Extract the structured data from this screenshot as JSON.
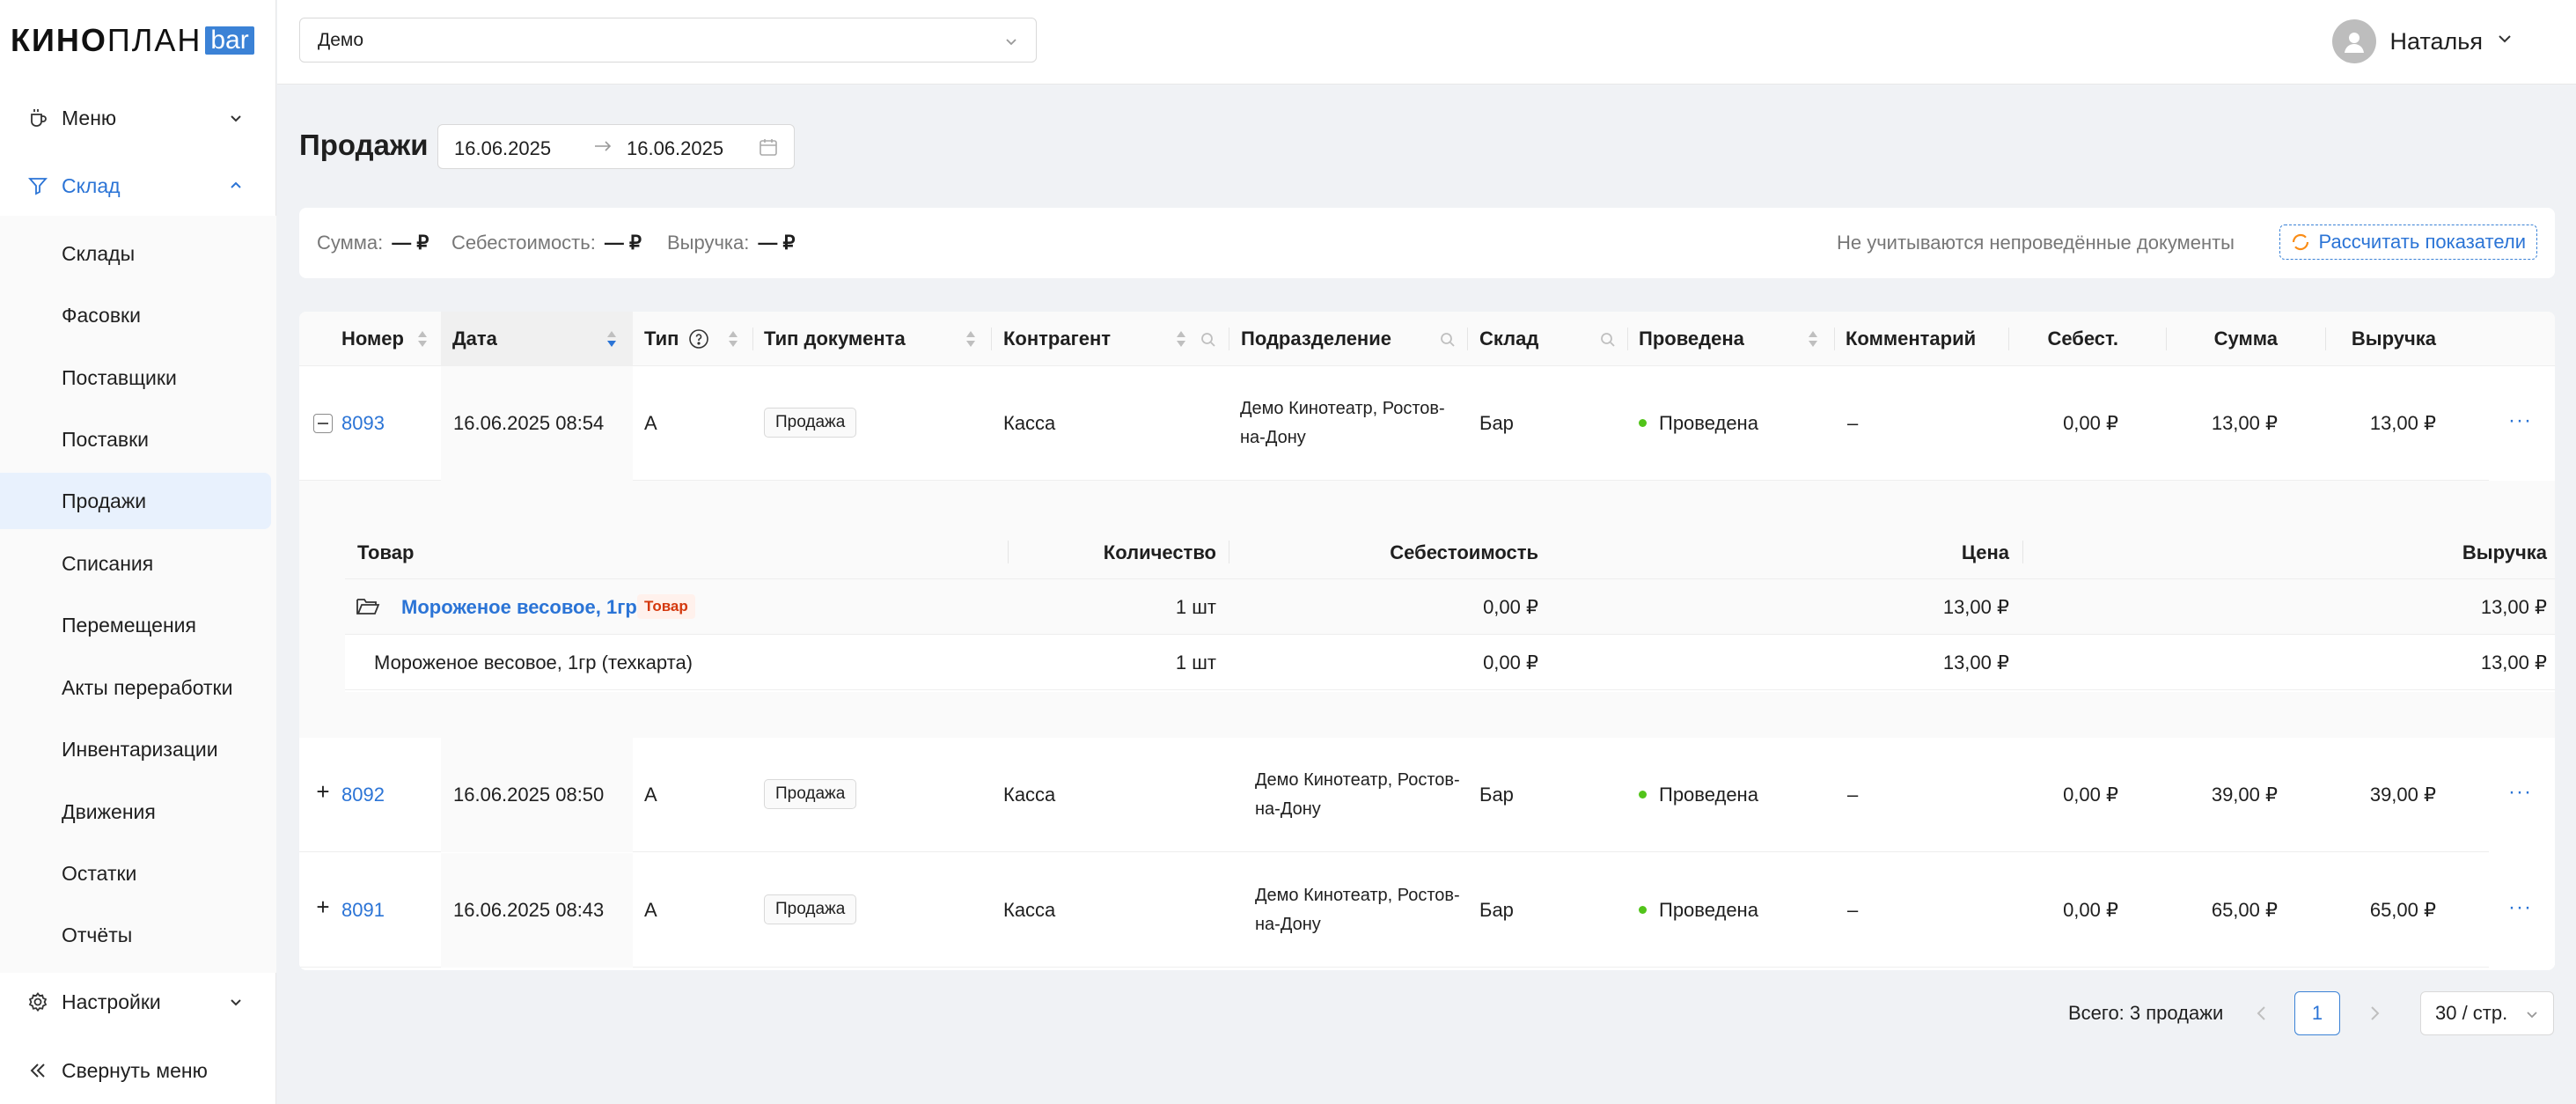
{
  "logo": {
    "bold": "КИНО",
    "light": "ПЛАН",
    "badge": "bar"
  },
  "sidebar": {
    "groups": [
      {
        "label": "Меню",
        "icon": "cup-icon"
      },
      {
        "label": "Склад",
        "icon": "funnel-icon"
      },
      {
        "label": "Настройки",
        "icon": "gear-icon"
      },
      {
        "label": "Свернуть меню",
        "icon": "double-chevron-left-icon"
      }
    ],
    "items": [
      "Склады",
      "Фасовки",
      "Поставщики",
      "Поставки",
      "Продажи",
      "Списания",
      "Перемещения",
      "Акты переработки",
      "Инвентаризации",
      "Движения",
      "Остатки",
      "Отчёты"
    ],
    "selected_item": "Продажи"
  },
  "topbar": {
    "org_select": "Демо",
    "user_name": "Наталья"
  },
  "page": {
    "title": "Продажи",
    "date_from": "16.06.2025",
    "date_to": "16.06.2025"
  },
  "metrics": {
    "sum_label": "Сумма:",
    "sum_value": "— ₽",
    "cost_label": "Себестоимость:",
    "cost_value": "— ₽",
    "revenue_label": "Выручка:",
    "revenue_value": "— ₽",
    "note": "Не учитываются непроведённые документы",
    "calc_button": "Рассчитать показатели"
  },
  "table": {
    "headers": {
      "number": "Номер",
      "date": "Дата",
      "type": "Тип",
      "doc_type": "Тип документа",
      "counterparty": "Контрагент",
      "division": "Подразделение",
      "warehouse": "Склад",
      "posted": "Проведена",
      "comment": "Комментарий",
      "cost": "Себест.",
      "sum": "Сумма",
      "revenue": "Выручка"
    },
    "rows": [
      {
        "number": "8093",
        "date": "16.06.2025 08:54",
        "type": "А",
        "doc_type": "Продажа",
        "counterparty": "Касса",
        "division_1": "Демо Кинотеатр, Ростов-",
        "division_2": "на-Дону",
        "warehouse": "Бар",
        "posted": "Проведена",
        "comment": "–",
        "cost": "0,00 ₽",
        "sum": "13,00 ₽",
        "revenue": "13,00 ₽",
        "more": "···"
      },
      {
        "number": "8092",
        "date": "16.06.2025 08:50",
        "type": "А",
        "doc_type": "Продажа",
        "counterparty": "Касса",
        "division_1": "Демо Кинотеатр, Ростов-",
        "division_2": "на-Дону",
        "warehouse": "Бар",
        "posted": "Проведена",
        "comment": "–",
        "cost": "0,00 ₽",
        "sum": "39,00 ₽",
        "revenue": "39,00 ₽",
        "more": "···",
        "expand": "+"
      },
      {
        "number": "8091",
        "date": "16.06.2025 08:43",
        "type": "А",
        "doc_type": "Продажа",
        "counterparty": "Касса",
        "division_1": "Демо Кинотеатр, Ростов-",
        "division_2": "на-Дону",
        "warehouse": "Бар",
        "posted": "Проведена",
        "comment": "–",
        "cost": "0,00 ₽",
        "sum": "65,00 ₽",
        "revenue": "65,00 ₽",
        "more": "···",
        "expand": "+"
      }
    ],
    "nested": {
      "headers": {
        "product": "Товар",
        "qty": "Количество",
        "cost": "Себестоимость",
        "price": "Цена",
        "revenue": "Выручка"
      },
      "group_row": {
        "name": "Мороженое весовое, 1гр",
        "tag": "Товар",
        "qty": "1 шт",
        "cost": "0,00 ₽",
        "price": "13,00 ₽",
        "revenue": "13,00 ₽"
      },
      "child_row": {
        "name": "Мороженое весовое, 1гр (техкарта)",
        "qty": "1 шт",
        "cost": "0,00 ₽",
        "price": "13,00 ₽",
        "revenue": "13,00 ₽"
      }
    }
  },
  "pagination": {
    "total": "Всего: 3 продажи",
    "current_page": "1",
    "page_size": "30 / стр."
  },
  "colors": {
    "accent": "#2b74d6",
    "posted_dot": "#52c41a",
    "tag_red": "#d4380d"
  }
}
